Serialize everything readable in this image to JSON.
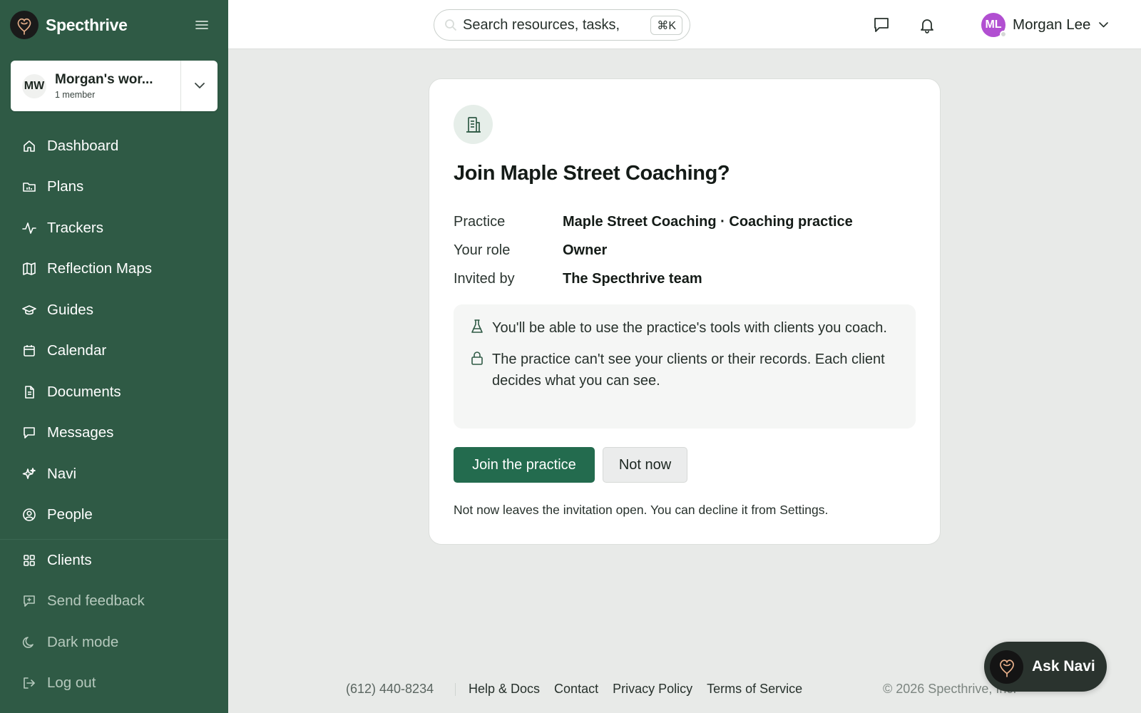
{
  "brand": {
    "name": "Specthrive"
  },
  "workspace": {
    "initials": "MW",
    "name": "Morgan's wor...",
    "members": "1 member"
  },
  "nav": {
    "items": [
      {
        "label": "Dashboard",
        "icon": "home-icon"
      },
      {
        "label": "Plans",
        "icon": "folder-chart-icon"
      },
      {
        "label": "Trackers",
        "icon": "activity-icon"
      },
      {
        "label": "Reflection Maps",
        "icon": "map-icon"
      },
      {
        "label": "Guides",
        "icon": "graduation-cap-icon"
      },
      {
        "label": "Calendar",
        "icon": "calendar-icon"
      },
      {
        "label": "Documents",
        "icon": "document-icon"
      },
      {
        "label": "Messages",
        "icon": "message-icon"
      },
      {
        "label": "Navi",
        "icon": "sparkles-icon"
      },
      {
        "label": "People",
        "icon": "user-circle-icon"
      },
      {
        "label": "Clients",
        "icon": "grid-icon"
      }
    ],
    "secondary": [
      {
        "label": "Send feedback",
        "icon": "feedback-icon"
      },
      {
        "label": "Dark mode",
        "icon": "moon-icon"
      },
      {
        "label": "Log out",
        "icon": "logout-icon"
      }
    ]
  },
  "topbar": {
    "search_placeholder": "Search resources, tasks,",
    "shortcut": "⌘K",
    "user": {
      "initials": "ML",
      "name": "Morgan Lee",
      "avatar_color": "#b14fd1"
    }
  },
  "card": {
    "title": "Join Maple Street Coaching?",
    "details": [
      {
        "label": "Practice",
        "value": "Maple Street Coaching · Coaching practice"
      },
      {
        "label": "Your role",
        "value": "Owner"
      },
      {
        "label": "Invited by",
        "value": "The Specthrive team"
      }
    ],
    "info": [
      {
        "icon": "flask-icon",
        "text": "You'll be able to use the practice's tools with clients you coach."
      },
      {
        "icon": "lock-icon",
        "text": "The practice can't see your clients or their records. Each client decides what you can see."
      }
    ],
    "primary_button": "Join the practice",
    "secondary_button": "Not now",
    "note": "Not now leaves the invitation open. You can decline it from Settings."
  },
  "footer": {
    "phone": "(612) 440-8234",
    "links": [
      "Help & Docs",
      "Contact",
      "Privacy Policy",
      "Terms of Service"
    ],
    "copyright": "© 2026 Specthrive, Inc."
  },
  "ask_navi": {
    "label": "Ask Navi"
  },
  "colors": {
    "sidebar": "#2f5a45",
    "primary": "#236b4e",
    "avatar": "#b14fd1"
  }
}
